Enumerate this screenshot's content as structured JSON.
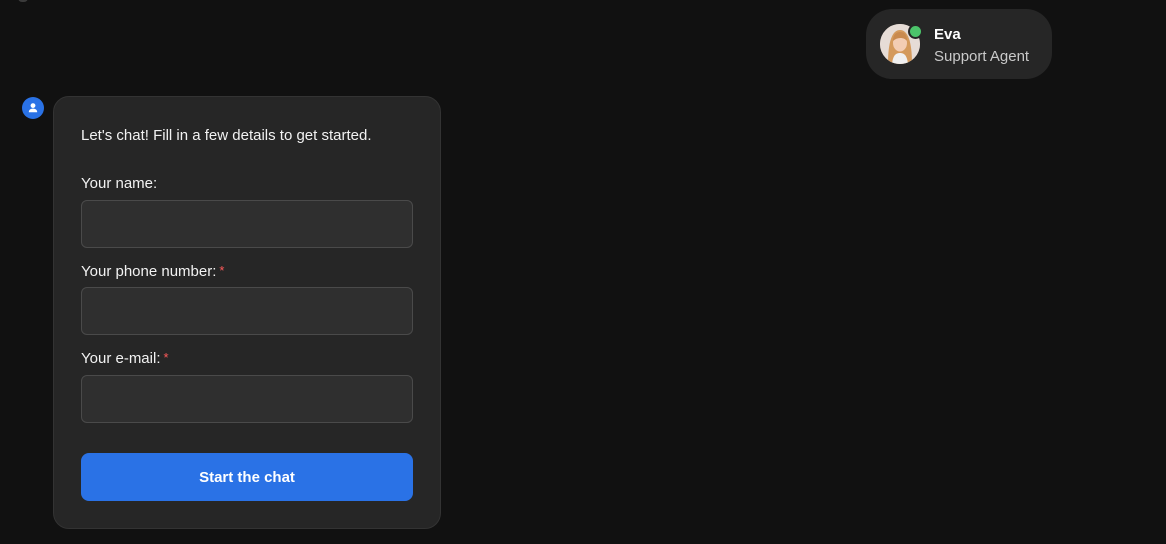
{
  "colors": {
    "background": "#111111",
    "card": "#262626",
    "accent": "#2a72e6",
    "online": "#4cc46a",
    "required": "#ff5a5a"
  },
  "agent": {
    "name": "Eva",
    "role": "Support Agent",
    "status": "online",
    "avatar_icon": "agent-photo"
  },
  "bot": {
    "icon": "user-icon"
  },
  "form": {
    "intro": "Let's chat! Fill in a few details to get started.",
    "fields": [
      {
        "label": "Your name:",
        "required": false,
        "value": "",
        "placeholder": ""
      },
      {
        "label": "Your phone number:",
        "required": true,
        "value": "",
        "placeholder": ""
      },
      {
        "label": "Your e-mail:",
        "required": true,
        "value": "",
        "placeholder": ""
      }
    ],
    "required_marker": "*",
    "submit_label": "Start the chat"
  }
}
